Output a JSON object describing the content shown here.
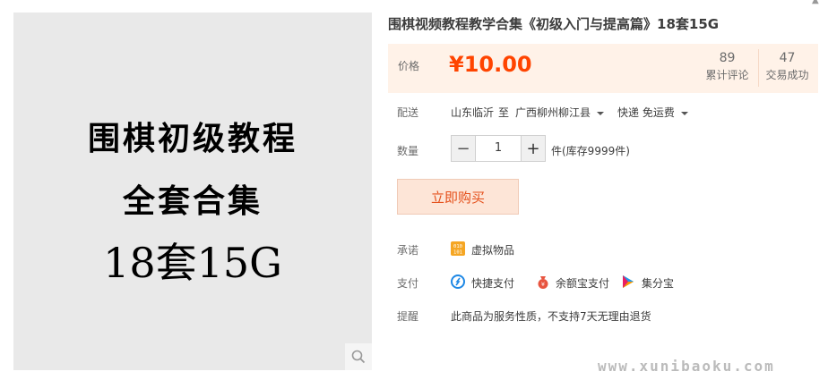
{
  "product_image": {
    "lines": [
      "围棋初级教程",
      "全套合集",
      "18套15G"
    ]
  },
  "title": "围棋视频教程教学合集《初级入门与提高篇》18套15G",
  "price": {
    "label": "价格",
    "value": "¥10.00",
    "reviews_count": "89",
    "reviews_label": "累计评论",
    "sales_count": "47",
    "sales_label": "交易成功"
  },
  "shipping": {
    "label": "配送",
    "from": "山东临沂",
    "to_word": "至",
    "destination": "广西柳州柳江县",
    "method": "快递 免运费"
  },
  "quantity": {
    "label": "数量",
    "value": "1",
    "minus": "−",
    "plus": "+",
    "stock": "件(库存9999件)"
  },
  "buy_button": "立即购买",
  "promise": {
    "label": "承诺",
    "item": "虚拟物品"
  },
  "payment": {
    "label": "支付",
    "methods": [
      "快捷支付",
      "余额宝支付",
      "集分宝"
    ]
  },
  "reminder": {
    "label": "提醒",
    "text": "此商品为服务性质，不支持7天无理由退货"
  },
  "watermark": "www.xunibaoku.com",
  "colors": {
    "accent": "#ff4400",
    "price_bg": "#fff2e8",
    "buy_bg": "#fde5d7"
  }
}
